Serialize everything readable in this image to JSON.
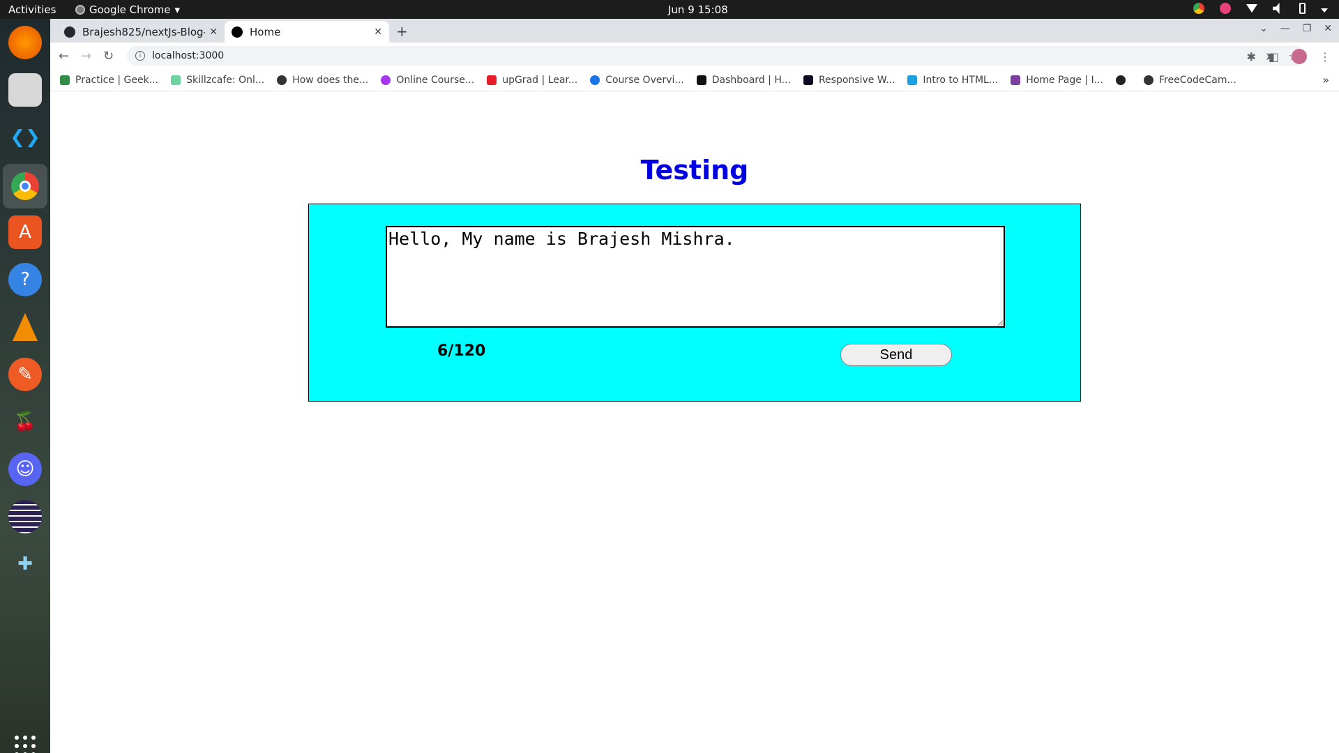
{
  "system": {
    "activities": "Activities",
    "app_name": "Google Chrome",
    "app_menu_arrow": "▾",
    "clock": "Jun 9  15:08"
  },
  "browser": {
    "tabs": [
      {
        "title": "Brajesh825/nextJs-Blog-",
        "icon": "github-icon",
        "close": "✕"
      },
      {
        "title": "Home",
        "icon": "nextjs-icon",
        "close": "✕"
      }
    ],
    "new_tab": "+",
    "url": "localhost:3000",
    "bookmarks": [
      {
        "label": "Practice | Geek...",
        "color": "#2f8d46"
      },
      {
        "label": "Skillzcafe: Onl...",
        "color": "#6dd3a0"
      },
      {
        "label": "How does the...",
        "color": "#333333"
      },
      {
        "label": "Online Course...",
        "color": "#a435f0"
      },
      {
        "label": "upGrad | Lear...",
        "color": "#e41e2b"
      },
      {
        "label": "Course Overvi...",
        "color": "#1a73e8"
      },
      {
        "label": "Dashboard | H...",
        "color": "#111111"
      },
      {
        "label": "Responsive W...",
        "color": "#0a0a23"
      },
      {
        "label": "Intro to HTML...",
        "color": "#1ba0e1"
      },
      {
        "label": "Home Page | I...",
        "color": "#7b3fa0"
      },
      {
        "label": "",
        "color": "#222222"
      },
      {
        "label": "FreeCodeCam...",
        "color": "#333333"
      }
    ],
    "more_bookmarks": "»"
  },
  "page": {
    "title": "Testing",
    "message": "Hello, My name is Brajesh Mishra. ",
    "counter": "6/120",
    "send_label": "Send"
  },
  "colors": {
    "title": "#0000e0",
    "panel": "#00ffff"
  }
}
